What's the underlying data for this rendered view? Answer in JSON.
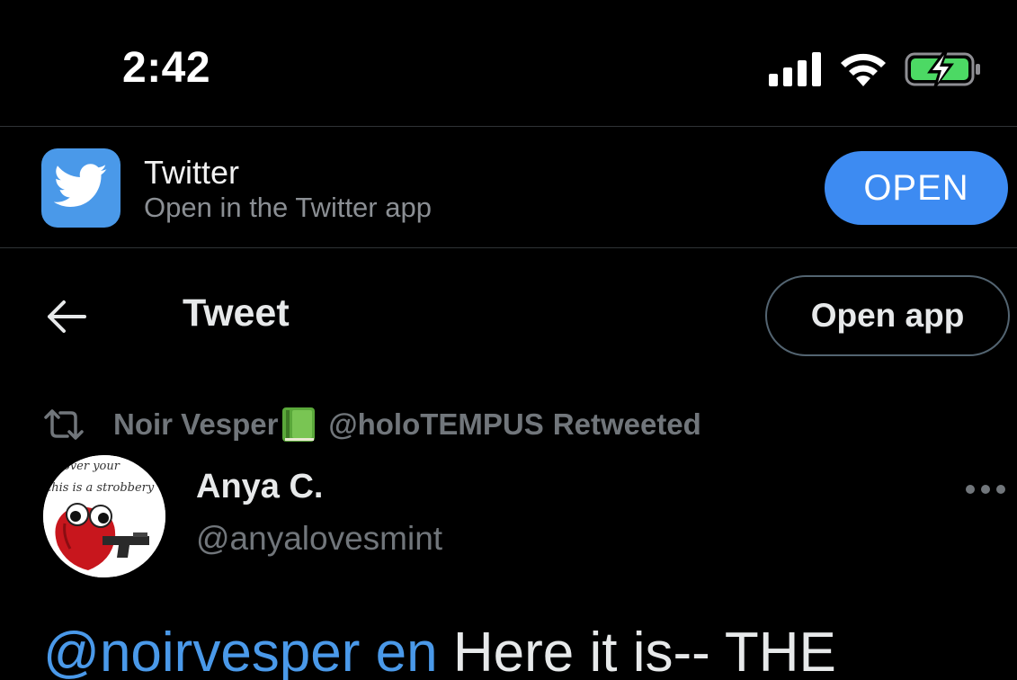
{
  "status_bar": {
    "time": "2:42",
    "signal_icon": "cellular-signal-icon",
    "wifi_icon": "wifi-icon",
    "battery_icon": "battery-charging-icon",
    "battery_color": "#4cd964"
  },
  "app_banner": {
    "app_name": "Twitter",
    "subtitle": "Open in the Twitter app",
    "open_label": "OPEN",
    "icon": "twitter-bird-icon",
    "accent": "#3d8bf2"
  },
  "header": {
    "title": "Tweet",
    "open_app_label": "Open app",
    "back_icon": "back-arrow-icon"
  },
  "retweet": {
    "retweeter_name": "Noir Vesper",
    "emoji": "green-book-icon",
    "retweeter_handle": "@holoTEMPUS",
    "suffix": "Retweeted"
  },
  "author": {
    "name": "Anya C.",
    "handle": "@anyalovesmint",
    "avatar_caption_1": "over your",
    "avatar_caption_2": "this is a strobbery"
  },
  "tweet": {
    "mention_1": "@noirvesper",
    "mention_2": "en",
    "text": "Here it is-- THE"
  }
}
